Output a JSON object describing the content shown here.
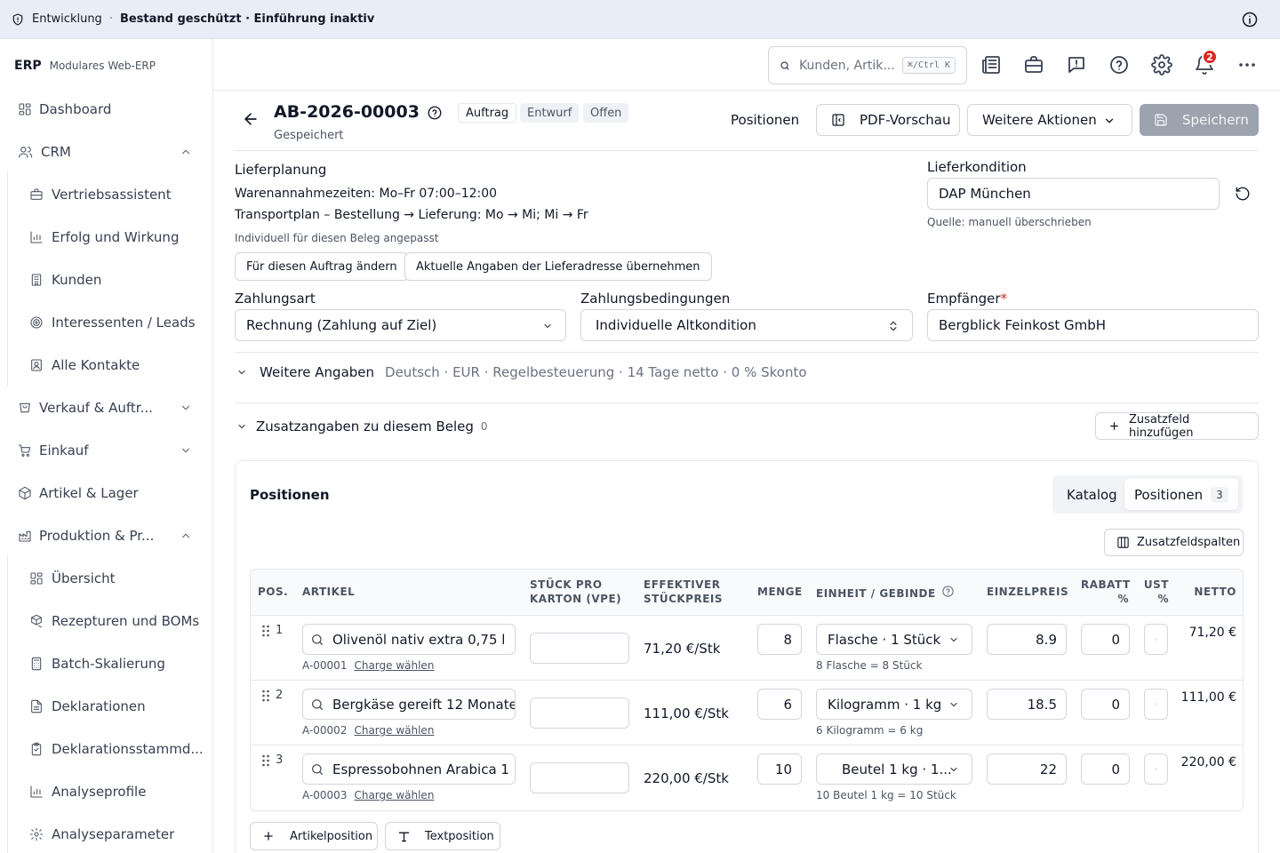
{
  "banner": {
    "environment": "Entwicklung",
    "separator": "·",
    "status": "Bestand geschützt · Einführung inaktiv"
  },
  "brand": {
    "name": "ERP",
    "subtitle": "Modulares Web-ERP"
  },
  "sidebar": {
    "items": [
      {
        "label": "Dashboard",
        "icon": "dashboard-icon"
      },
      {
        "label": "CRM",
        "icon": "users-icon",
        "expanded": true
      },
      {
        "label": "Vertriebsassistent",
        "icon": "briefcase-icon"
      },
      {
        "label": "Erfolg und Wirkung",
        "icon": "chart-icon"
      },
      {
        "label": "Kunden",
        "icon": "building-icon"
      },
      {
        "label": "Interessenten / Leads",
        "icon": "target-icon"
      },
      {
        "label": "Alle Kontakte",
        "icon": "contact-icon"
      },
      {
        "label": "Verkauf & Auftr...",
        "icon": "cart-icon",
        "expanded": false
      },
      {
        "label": "Einkauf",
        "icon": "shopping-cart-icon",
        "expanded": false
      },
      {
        "label": "Artikel & Lager",
        "icon": "box-icon"
      },
      {
        "label": "Produktion & Pr...",
        "icon": "factory-icon",
        "expanded": true
      },
      {
        "label": "Übersicht",
        "icon": "grid-icon"
      },
      {
        "label": "Rezepturen und BOMs",
        "icon": "boxes-icon"
      },
      {
        "label": "Batch-Skalierung",
        "icon": "calculator-icon"
      },
      {
        "label": "Deklarationen",
        "icon": "file-icon"
      },
      {
        "label": "Deklarationsstammd...",
        "icon": "clipboard-icon"
      },
      {
        "label": "Analyseprofile",
        "icon": "bar-chart-icon"
      },
      {
        "label": "Analyseparameter",
        "icon": "gear-icon"
      }
    ]
  },
  "topbar": {
    "search_placeholder": "Kunden, Artik...",
    "shortcut": "⌘/Ctrl K",
    "notifications": "2"
  },
  "document": {
    "number": "AB-2026-00003",
    "type": "Auftrag",
    "status_draft": "Entwurf",
    "status_open": "Offen",
    "saved": "Gespeichert"
  },
  "actions": {
    "positions": "Positionen",
    "pdf_preview": "PDF-Vorschau",
    "more": "Weitere Aktionen",
    "save": "Speichern"
  },
  "delivery": {
    "title": "Lieferplanung",
    "hours": "Warenannahmezeiten: Mo–Fr 07:00–12:00",
    "transport": "Transportplan – Bestellung → Lieferung: Mo → Mi; Mi → Fr",
    "note": "Individuell für diesen Beleg angepasst",
    "change_btn": "Für diesen Auftrag ändern",
    "apply_btn": "Aktuelle Angaben der Lieferadresse übernehmen",
    "condition_label": "Lieferkondition",
    "condition_value": "DAP München",
    "condition_source": "Quelle: manuell überschrieben"
  },
  "payment": {
    "method_label": "Zahlungsart",
    "method_value": "Rechnung (Zahlung auf Ziel)",
    "terms_label": "Zahlungsbedingungen",
    "terms_value": "Individuelle Altkondition",
    "recipient_label": "Empfänger",
    "recipient_required": "*",
    "recipient_value": "Bergblick Feinkost GmbH"
  },
  "more_info": {
    "title": "Weitere Angaben",
    "summary": "Deutsch · EUR · Regelbesteuerung · 14 Tage netto · 0 % Skonto"
  },
  "extra": {
    "title": "Zusatzangaben zu diesem Beleg",
    "count": "0",
    "add_btn": "Zusatzfeld hinzufügen"
  },
  "positions": {
    "title": "Positionen",
    "tab_catalog": "Katalog",
    "tab_positions": "Positionen",
    "count": "3",
    "columns_btn": "Zusatzfeldspalten",
    "headers": {
      "pos": "POS.",
      "article": "ARTIKEL",
      "vpe_1": "STÜCK PRO",
      "vpe_2": "KARTON (VPE)",
      "eff_1": "EFFEKTIVER",
      "eff_2": "STÜCKPREIS",
      "qty": "MENGE",
      "unit": "EINHEIT / GEBINDE",
      "price": "EINZELPREIS",
      "discount_1": "RABATT",
      "discount_2": "%",
      "vat_1": "UST",
      "vat_2": "%",
      "net": "NETTO"
    },
    "rows": [
      {
        "pos": "1",
        "article": "Olivenöl nativ extra 0,75 l",
        "sku": "A-00001",
        "batch": "Charge wählen",
        "eff_price": "71,20 €/Stk",
        "qty": "8",
        "unit": "Flasche · 1 Stück",
        "unit_note": "8 Flasche = 8 Stück",
        "price": "8.9",
        "discount": "0",
        "vat": "·",
        "net": "71,20 €"
      },
      {
        "pos": "2",
        "article": "Bergkäse gereift 12 Monate",
        "sku": "A-00002",
        "batch": "Charge wählen",
        "eff_price": "111,00 €/Stk",
        "qty": "6",
        "unit": "Kilogramm · 1 kg",
        "unit_note": "6 Kilogramm = 6 kg",
        "price": "18.5",
        "discount": "0",
        "vat": "·",
        "net": "111,00 €"
      },
      {
        "pos": "3",
        "article": "Espressobohnen Arabica 1 kg",
        "sku": "A-00003",
        "batch": "Charge wählen",
        "eff_price": "220,00 €/Stk",
        "qty": "10",
        "unit": "Beutel 1 kg · 1...",
        "unit_note": "10 Beutel 1 kg = 10 Stück",
        "price": "22",
        "discount": "0",
        "vat": "·",
        "net": "220,00 €"
      }
    ],
    "add_article": "Artikelposition",
    "add_text": "Textposition"
  },
  "colors": {
    "accent": "#111827",
    "muted": "#6b7280",
    "border": "#d1d5db",
    "banner_bg": "#e9eef6",
    "save_disabled": "#9ca3af",
    "badge": "#dc2626"
  }
}
